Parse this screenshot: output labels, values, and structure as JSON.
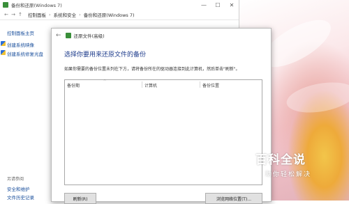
{
  "window": {
    "title": "备份和还原(Windows 7)",
    "controls": {
      "minimize": "—",
      "maximize": "☐",
      "close": "✕"
    }
  },
  "addressbar": {
    "back": "←",
    "forward": "→",
    "up": "↑",
    "crumbs": [
      "控制面板",
      "系统和安全",
      "备份和还原(Windows 7)"
    ],
    "separator": "›"
  },
  "sidebar": {
    "home": "控制面板主页",
    "links": [
      "创建系统映像",
      "创建系统修复光盘"
    ],
    "see_also_title": "另请参阅",
    "see_also": [
      "安全和维护",
      "文件历史记录"
    ]
  },
  "dialog": {
    "title": "还原文件(高级)",
    "heading": "选择你要用来还原文件的备份",
    "instruction": "如果你需要的备份位置未列在下方，请将备份所在的驱动器连接到此计算机，然后单击\"刷新\"。",
    "columns": [
      "备份期",
      "计算机",
      "备份位置"
    ],
    "buttons": {
      "refresh": "刷新(R)",
      "browse": "浏览网络位置(T)..."
    }
  },
  "watermark": {
    "title": "百科全说",
    "subtitle": "助你轻松解决"
  }
}
